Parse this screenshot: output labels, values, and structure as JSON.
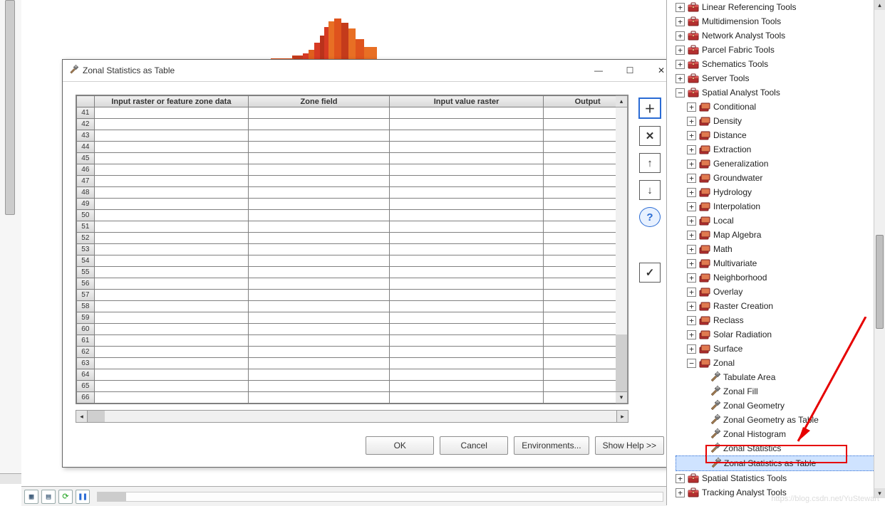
{
  "dialog": {
    "title": "Zonal Statistics as Table",
    "columns": [
      "Input raster or feature zone data",
      "Zone field",
      "Input value raster",
      "Output"
    ],
    "row_start": 41,
    "row_end": 66,
    "buttons": {
      "ok": "OK",
      "cancel": "Cancel",
      "environments": "Environments...",
      "showhelp": "Show Help >>"
    }
  },
  "sidebar": {
    "top_toolboxes": [
      "Linear Referencing Tools",
      "Multidimension Tools",
      "Network Analyst Tools",
      "Parcel Fabric Tools",
      "Schematics Tools",
      "Server Tools"
    ],
    "spatial_analyst": {
      "label": "Spatial Analyst Tools",
      "toolsets": [
        "Conditional",
        "Density",
        "Distance",
        "Extraction",
        "Generalization",
        "Groundwater",
        "Hydrology",
        "Interpolation",
        "Local",
        "Map Algebra",
        "Math",
        "Multivariate",
        "Neighborhood",
        "Overlay",
        "Raster Creation",
        "Reclass",
        "Solar Radiation",
        "Surface"
      ],
      "zonal": {
        "label": "Zonal",
        "tools": [
          "Tabulate Area",
          "Zonal Fill",
          "Zonal Geometry",
          "Zonal Geometry as Table",
          "Zonal Histogram",
          "Zonal Statistics",
          "Zonal Statistics as Table"
        ]
      }
    },
    "bottom_toolboxes": [
      "Spatial Statistics Tools",
      "Tracking Analyst Tools"
    ]
  },
  "watermark": "https://blog.csdn.net/YuStewart"
}
